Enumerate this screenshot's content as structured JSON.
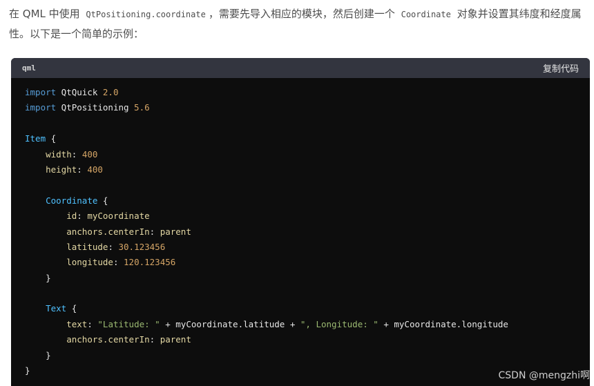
{
  "intro": {
    "part1": "在 QML 中使用 ",
    "code1": "QtPositioning.coordinate",
    "part2": "，需要先导入相应的模块，然后创建一个 ",
    "code2": "Coordinate",
    "part3": " 对象并设置其纬度和经度属性。以下是一个简单的示例："
  },
  "code_block": {
    "language": "qml",
    "copy_label": "复制代码",
    "lines": {
      "l1": {
        "kw": "import",
        "name": " QtQuick ",
        "ver": "2.0"
      },
      "l2": {
        "kw": "import",
        "name": " QtPositioning ",
        "ver": "5.6"
      },
      "l4": {
        "type": "Item",
        "brace": " {"
      },
      "l5": {
        "indent": "    ",
        "prop": "width",
        "colon": ": ",
        "val": "400"
      },
      "l6": {
        "indent": "    ",
        "prop": "height",
        "colon": ": ",
        "val": "400"
      },
      "l8": {
        "indent": "    ",
        "type": "Coordinate",
        "brace": " {"
      },
      "l9": {
        "indent": "        ",
        "prop": "id",
        "colon": ": ",
        "val": "myCoordinate"
      },
      "l10": {
        "indent": "        ",
        "prop": "anchors.centerIn",
        "colon": ": ",
        "val": "parent"
      },
      "l11": {
        "indent": "        ",
        "prop": "latitude",
        "colon": ": ",
        "val": "30.123456"
      },
      "l12": {
        "indent": "        ",
        "prop": "longitude",
        "colon": ": ",
        "val": "120.123456"
      },
      "l13": {
        "indent": "    ",
        "brace": "}"
      },
      "l15": {
        "indent": "    ",
        "type": "Text",
        "brace": " {"
      },
      "l16": {
        "indent": "        ",
        "prop": "text",
        "colon": ": ",
        "s1": "\"Latitude: \"",
        "op1": " + myCoordinate.latitude + ",
        "s2": "\", Longitude: \"",
        "op2": " + myCoordinate.longitude"
      },
      "l17": {
        "indent": "        ",
        "prop": "anchors.centerIn",
        "colon": ": ",
        "val": "parent"
      },
      "l18": {
        "indent": "    ",
        "brace": "}"
      },
      "l19": {
        "brace": "}"
      }
    }
  },
  "watermark": "CSDN @mengzhi啊",
  "colors": {
    "keyword": "#569cd6",
    "type": "#4fc1ff",
    "property": "#e4d8a4",
    "number": "#d5a566",
    "string": "#9bb971",
    "code_bg": "#0d0d0d",
    "header_bg": "#33353f"
  }
}
